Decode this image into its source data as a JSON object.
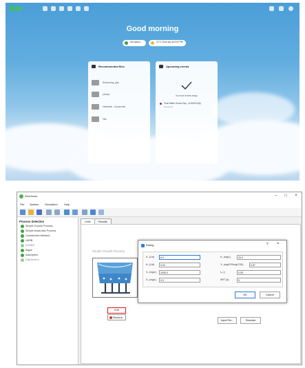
{
  "desktop": {
    "greeting": "Good morning",
    "status_buttons": [
      {
        "label": "Set status",
        "dot_color": "#3aa04a"
      },
      {
        "label": "11°C Clear sky at 9:00 PM",
        "dot_color": "#e2b93b"
      }
    ],
    "recommended": {
      "title": "Recommended files",
      "files": [
        "Resourcing_plan",
        "privacy",
        "Intellisuite - Documents",
        "Talk"
      ]
    },
    "events": {
      "title": "Upcoming events",
      "empty_message": "No more events today",
      "items": [
        {
          "title": "Final Water House Day - 6/15/2024(5)",
          "subtitle": "Tomorrow"
        }
      ]
    }
  },
  "app": {
    "title": "SimHouse",
    "menu": [
      "File",
      "System",
      "Simulation",
      "Help"
    ],
    "sidebar": {
      "heading": "Process Selection",
      "items": [
        {
          "label": "Simple Growth Process",
          "color": "#3fa33f"
        },
        {
          "label": "Simple Anaerobic Process",
          "color": "#3fa33f"
        },
        {
          "label": "Constructed Wetland",
          "color": "#3fa33f"
        },
        {
          "label": "UASB",
          "color": "#3fa33f"
        },
        {
          "label": "AnMBR",
          "color": "#9ac79a"
        },
        {
          "label": "Algae",
          "color": "#3fa33f"
        },
        {
          "label": "Adsorption",
          "color": "#3fa33f"
        },
        {
          "label": "Disinfection",
          "color": "#9ac79a"
        }
      ]
    },
    "tabs": [
      "Units",
      "Results"
    ],
    "diagram_title": "Simple Growth Process",
    "edit_label": "Edit",
    "remove_label": "Remove",
    "input_file_label": "Input File...",
    "simulate_label": "Simulate",
    "dialog": {
      "title": "Dialog",
      "help": "?",
      "fields_left": [
        {
          "label": "Kₛ (1/d)",
          "value": "6.0"
        },
        {
          "label": "Kₑ (1/d)",
          "value": "0.02"
        },
        {
          "label": "Xₒ (mg/L)",
          "value": "2000.0"
        },
        {
          "label": "Sₒ (mg/L)",
          "value": "0.0"
        }
      ],
      "fields_right": [
        {
          "label": "Kₛ (mg/L)",
          "value": "20.0"
        },
        {
          "label": "Yₕ (mgVSS/mgCOD)",
          "value": "0.67"
        },
        {
          "label": "fₑ (-)",
          "value": "0.05"
        },
        {
          "label": "SRT (d)",
          "value": "5"
        }
      ],
      "ok_label": "OK",
      "cancel_label": "Cancel"
    }
  }
}
